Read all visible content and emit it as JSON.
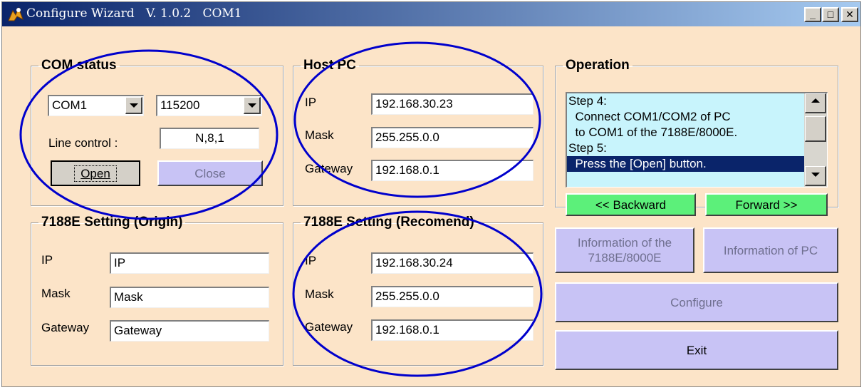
{
  "window": {
    "title": "Configure Wizard   V. 1.0.2   COM1",
    "controls": {
      "minimize": "_",
      "maximize": "□",
      "close": "✕"
    }
  },
  "com_status": {
    "legend": "COM status",
    "port": "COM1",
    "baud": "115200",
    "line_control_label": "Line control :",
    "line_control_value": "N,8,1",
    "open_label": "Open",
    "close_label": "Close"
  },
  "host_pc": {
    "legend": "Host PC",
    "ip_label": "IP",
    "ip": "192.168.30.23",
    "mask_label": "Mask",
    "mask": "255.255.0.0",
    "gateway_label": "Gateway",
    "gateway": "192.168.0.1"
  },
  "origin": {
    "legend": "7188E Setting (Origin)",
    "ip_label": "IP",
    "ip": "IP",
    "mask_label": "Mask",
    "mask": "Mask",
    "gateway_label": "Gateway",
    "gateway": "Gateway"
  },
  "recommend": {
    "legend": "7188E Setting (Recomend)",
    "ip_label": "IP",
    "ip": "192.168.30.24",
    "mask_label": "Mask",
    "mask": "255.255.0.0",
    "gateway_label": "Gateway",
    "gateway": "192.168.0.1"
  },
  "operation": {
    "legend": "Operation",
    "lines": [
      "Step 4:",
      "  Connect COM1/COM2 of PC",
      "  to COM1 of the 7188E/8000E.",
      "Step 5:",
      "  Press the [Open] button."
    ],
    "selected_index": 4,
    "backward_label": "<< Backward",
    "forward_label": "Forward >>"
  },
  "buttons": {
    "info_device_line1": "Information of the",
    "info_device_line2": "7188E/8000E",
    "info_pc": "Information of  PC",
    "configure": "Configure",
    "exit": "Exit"
  },
  "colors": {
    "window_bg": "#FCE4C8",
    "button_bg": "#C8C3F5",
    "green_button": "#5CF07A",
    "listbox_bg": "#C8F4FC",
    "annotation": "#0000CC"
  }
}
